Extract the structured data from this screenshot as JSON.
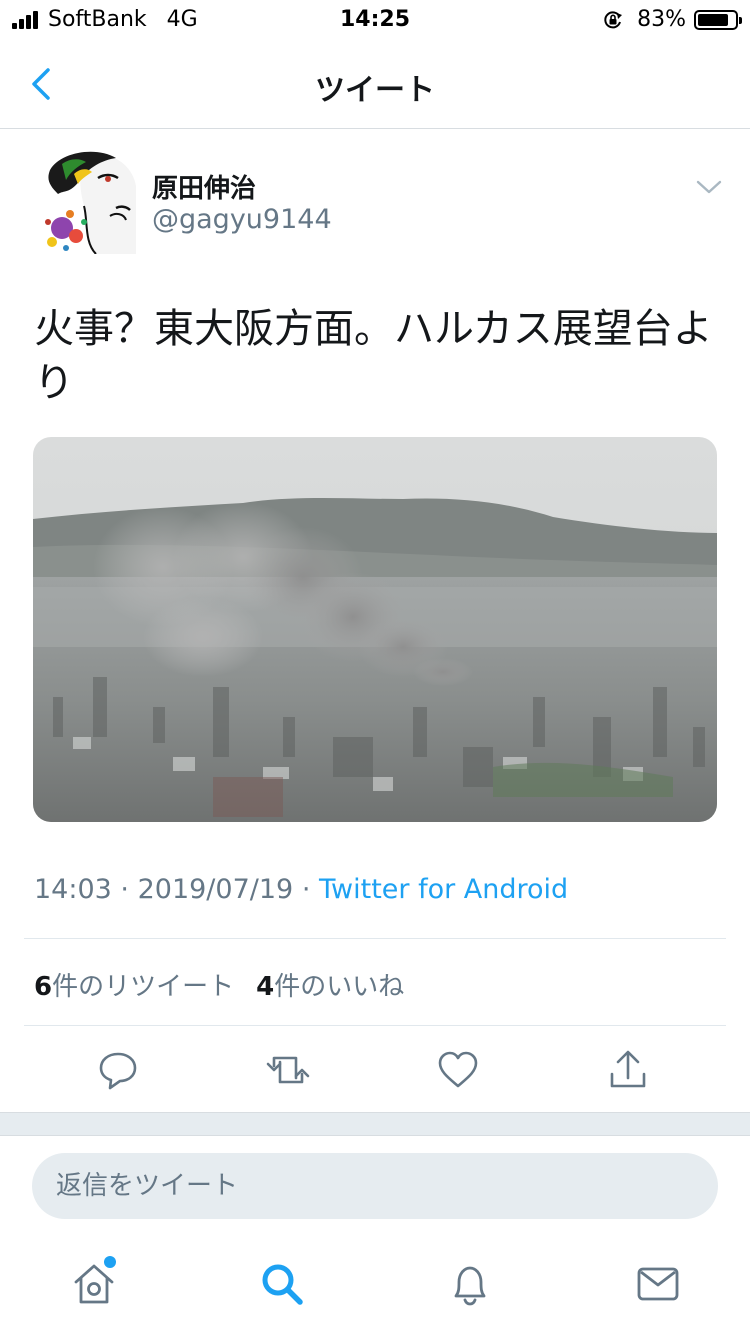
{
  "status_bar": {
    "carrier": "SoftBank",
    "network": "4G",
    "time": "14:25",
    "battery_percent": "83%",
    "battery_level": 0.83,
    "icons": [
      "signal-icon",
      "orientation-lock-icon",
      "battery-icon"
    ]
  },
  "nav": {
    "back_icon": "chevron-left-icon",
    "title": "ツイート"
  },
  "tweet": {
    "author": {
      "display_name": "原田伸治",
      "handle": "@gagyu9144"
    },
    "text": "火事？東大阪方面。ハルカス展望台より",
    "media": {
      "type": "photo"
    },
    "time": "14:03",
    "separator": "·",
    "date": "2019/07/19",
    "source": "Twitter for Android",
    "stats": {
      "retweets_count": "6",
      "retweets_label": "件のリツイート",
      "likes_count": "4",
      "likes_label": "件のいいね"
    },
    "actions": [
      "reply-icon",
      "retweet-icon",
      "like-icon",
      "share-icon"
    ]
  },
  "reply": {
    "placeholder": "返信をツイート"
  },
  "tab_bar": {
    "tabs": [
      "home-icon",
      "search-icon",
      "notifications-icon",
      "messages-icon"
    ],
    "home_has_new": true
  },
  "colors": {
    "accent": "#1da1f2",
    "text_primary": "#14171a",
    "text_secondary": "#657786",
    "divider": "#e1e8ed",
    "reply_box_bg": "#e6ecf0"
  }
}
